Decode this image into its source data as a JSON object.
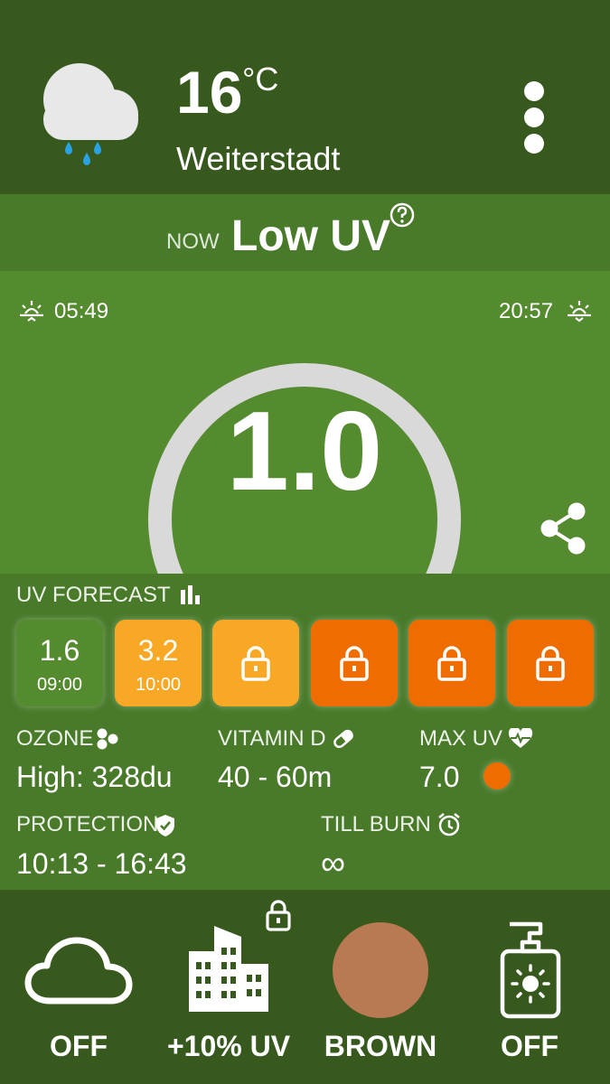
{
  "header": {
    "temperature": "16",
    "unit": "°C",
    "city": "Weiterstadt",
    "weather_icon": "cloud-rain-icon",
    "menu_icon": "more-vertical-icon"
  },
  "status": {
    "now_label": "NOW",
    "level_text": "Low UV",
    "help_icon": "help-circle-icon"
  },
  "gauge": {
    "sunrise": "05:49",
    "sunset": "20:57",
    "uv_value": "1.0",
    "uv_fraction": 0.085,
    "share_icon": "share-icon"
  },
  "forecast": {
    "title": "UV FORECAST",
    "items": [
      {
        "value": "1.6",
        "time": "09:00",
        "locked": false,
        "color": "#558b2f"
      },
      {
        "value": "3.2",
        "time": "10:00",
        "locked": false,
        "color": "#f9a825"
      },
      {
        "locked": true,
        "color": "#f9a825"
      },
      {
        "locked": true,
        "color": "#ef6c00"
      },
      {
        "locked": true,
        "color": "#ef6c00"
      },
      {
        "locked": true,
        "color": "#ef6c00"
      }
    ]
  },
  "stats": {
    "ozone_label": "OZONE",
    "ozone_value": "High: 328du",
    "vitamin_d_label": "VITAMIN D",
    "vitamin_d_value": "40 - 60m",
    "max_uv_label": "MAX UV",
    "max_uv_value": "7.0",
    "max_uv_color": "#ef6c00",
    "protection_label": "PROTECTION",
    "protection_value": "10:13 - 16:43",
    "till_burn_label": "TILL BURN",
    "till_burn_value": "∞"
  },
  "bottom": {
    "cloud_label": "OFF",
    "building_label": "+10% UV",
    "skin_label": "BROWN",
    "skin_color": "#b97952",
    "sunscreen_label": "OFF"
  },
  "colors": {
    "header_bg": "#37591e",
    "band_bg": "#487a2a",
    "gauge_bg": "#558b2f",
    "gauge_track": "#d9d9d9",
    "gauge_fill": "#3a6b25"
  }
}
